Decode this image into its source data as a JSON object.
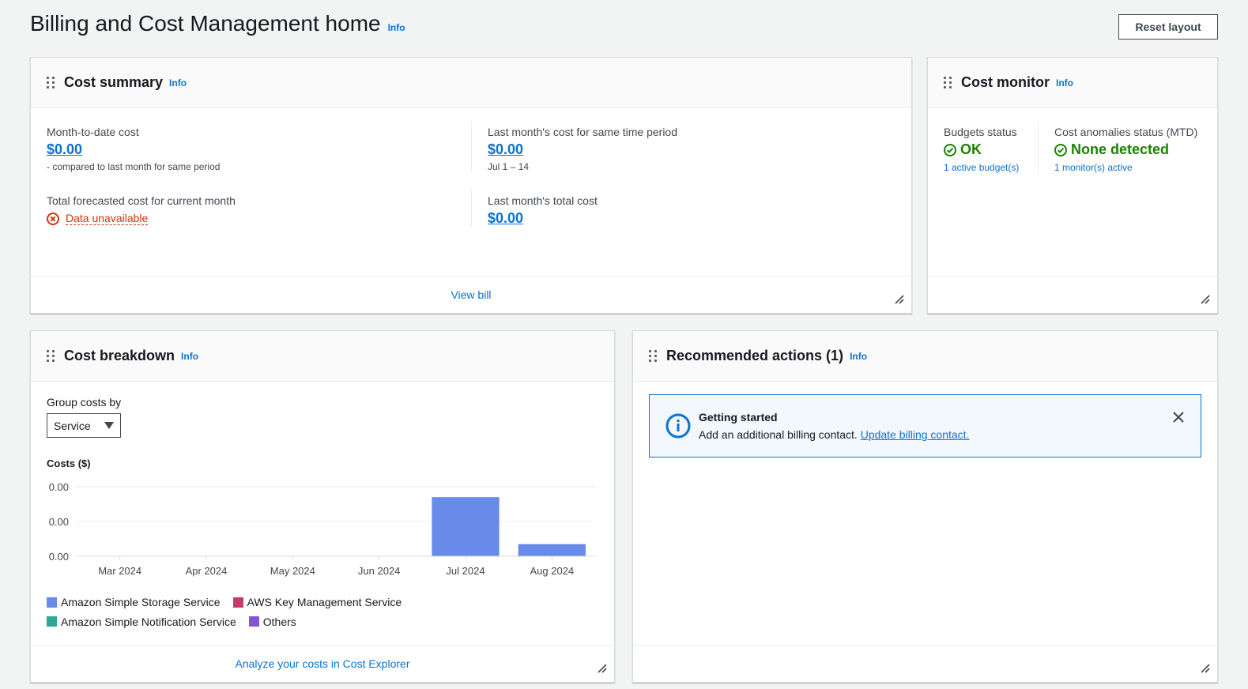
{
  "page": {
    "title": "Billing and Cost Management home",
    "info": "Info",
    "reset_label": "Reset layout"
  },
  "cost_summary": {
    "title": "Cost summary",
    "info": "Info",
    "mtd_label": "Month-to-date cost",
    "mtd_value": "$0.00",
    "mtd_note": "- compared to last month for same period",
    "forecast_label": "Total forecasted cost for current month",
    "forecast_value": "Data unavailable",
    "last_same_label": "Last month's cost for same time period",
    "last_same_value": "$0.00",
    "last_same_range": "Jul 1 – 14",
    "last_total_label": "Last month's total cost",
    "last_total_value": "$0.00",
    "footer_link": "View bill"
  },
  "cost_monitor": {
    "title": "Cost monitor",
    "info": "Info",
    "budgets_label": "Budgets status",
    "budgets_value": "OK",
    "budgets_link": "1 active budget(s)",
    "anomalies_label": "Cost anomalies status (MTD)",
    "anomalies_value": "None detected",
    "anomalies_link": "1 monitor(s) active"
  },
  "cost_breakdown": {
    "title": "Cost breakdown",
    "info": "Info",
    "group_label": "Group costs by",
    "group_value": "Service",
    "footer_link": "Analyze your costs in Cost Explorer"
  },
  "chart_data": {
    "type": "bar",
    "title": "Costs ($)",
    "categories": [
      "Mar 2024",
      "Apr 2024",
      "May 2024",
      "Jun 2024",
      "Jul 2024",
      "Aug 2024"
    ],
    "y_tick_labels": [
      "0.00",
      "0.00",
      "0.00"
    ],
    "series": [
      {
        "name": "Amazon Simple Storage Service",
        "color": "#688ae8",
        "values": [
          0,
          0,
          0,
          0,
          0.0034,
          0.0007
        ]
      },
      {
        "name": "AWS Key Management Service",
        "color": "#c33d69",
        "values": [
          0,
          0,
          0,
          0,
          0,
          0
        ]
      },
      {
        "name": "Amazon Simple Notification Service",
        "color": "#2ea597",
        "values": [
          0,
          0,
          0,
          0,
          0,
          0
        ]
      },
      {
        "name": "Others",
        "color": "#8456ce",
        "values": [
          0,
          0,
          0,
          0,
          0,
          0
        ]
      }
    ],
    "ylim": [
      0,
      0.004
    ],
    "grid": true,
    "legend_position": "bottom"
  },
  "recommended": {
    "title": "Recommended actions (1)",
    "info": "Info",
    "alert_title": "Getting started",
    "alert_text": "Add an additional billing contact.",
    "alert_link": "Update billing contact."
  }
}
